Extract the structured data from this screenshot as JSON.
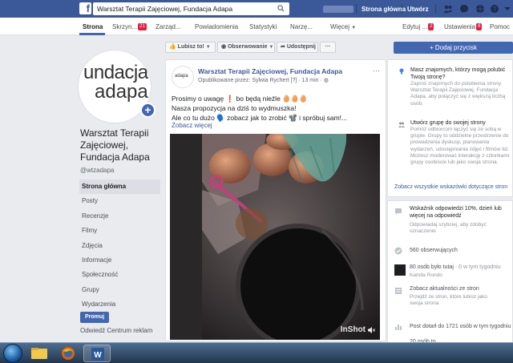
{
  "topbar": {
    "logo": "f",
    "search_value": "Warsztat Terapii Zajęciowej, Fundacja Adapa",
    "home_label": "Strona główna",
    "create_label": "Utwórz"
  },
  "tabs": [
    {
      "label": "Strona"
    },
    {
      "label": "Skrzyn...",
      "badge": "21"
    },
    {
      "label": "Zarząd..."
    },
    {
      "label": "Powiadomienia"
    },
    {
      "label": "Statystyki"
    },
    {
      "label": "Narzę..."
    },
    {
      "label": "Więcej"
    },
    {
      "label": "Edytuj ...",
      "badge": "2"
    },
    {
      "label": "Ustawienia",
      "badge": "8"
    },
    {
      "label": "Pomoc"
    }
  ],
  "profile": {
    "logo_line1": "undacja",
    "logo_line2": "adapa",
    "name": "Warsztat Terapii Zajęciowej, Fundacja Adapa",
    "handle": "@wtzadapa"
  },
  "left_nav": [
    "Strona główna",
    "Posty",
    "Recenzje",
    "Filmy",
    "Zdjęcia",
    "Informacje",
    "Społeczność",
    "Grupy",
    "Wydarzenia"
  ],
  "promote_label": "Promuj",
  "ads_center_label": "Odwiedź Centrum reklam",
  "actions": {
    "like": "Lubisz to!",
    "follow": "Obserwowanie",
    "share": "Udostępnij",
    "more": "···"
  },
  "post": {
    "author": "Warsztat Terapii Zajęciowej, Fundacja Adapa",
    "meta": "Opublikowane przez: Sylwia Rychert [?] · 13 min · ",
    "line1": "Prosimy o uwagę ❗ bo będą nieźle 🥚🥚🥚",
    "line2": "Nasza propozycja na dziś to wydmuszka!",
    "line3": "Ale co tu dużo 🗣️ zobacz jak to zrobić 📽️ i spróbuj sam!...",
    "see_more": "Zobacz więcej",
    "video_watermark": "InShot"
  },
  "right": {
    "add_button": "+ Dodaj przycisk",
    "tip1_title": "Masz znajomych, którzy mogą polubić Twoją stronę?",
    "tip1_desc": "Zaproś znajomych do polubienia strony Warsztat Terapii Zajęciowej, Fundacja Adapa, aby połączyć się z większą liczbą osób.",
    "tip2_title": "Utwórz grupę do swojej strony",
    "tip2_desc": "Pomóż odbiorcom łączyć się ze sobą w grupie. Grupy to oddzielne przestrzenie do prowadzenia dyskusji, planowania wydarzeń, udostępniania zdjęć i filmów itd. Możesz moderować interakcję z członkami grupy osobiście lub jako swoja strona.",
    "all_tips_link": "Zobacz wszystkie wskazówki dotyczące stron",
    "response_title": "Wskaźnik odpowiedzi 10%, dzień lub więcej na odpowiedź",
    "response_desc": "Odpowiadaj szybciej, aby zdobyć oznaczenie",
    "followers": "560 obserwujących",
    "visits_title": "80 osób było tutaj",
    "visits_suffix": "0 w tym tygodniu",
    "visitor_name": "Kamila Rondo",
    "news_title": "Zobacz aktualności ze stron",
    "news_desc": "Przejdź ze stron, które lubisz jako swoja strona",
    "reach": "Post dotarł do 1721 osób w tym tygodniu",
    "more_row": "20 osób to"
  },
  "colors": {
    "facebook_blue": "#3b5998",
    "button_blue": "#4267b2",
    "link_blue": "#385898",
    "badge_red": "#e41e3f"
  }
}
